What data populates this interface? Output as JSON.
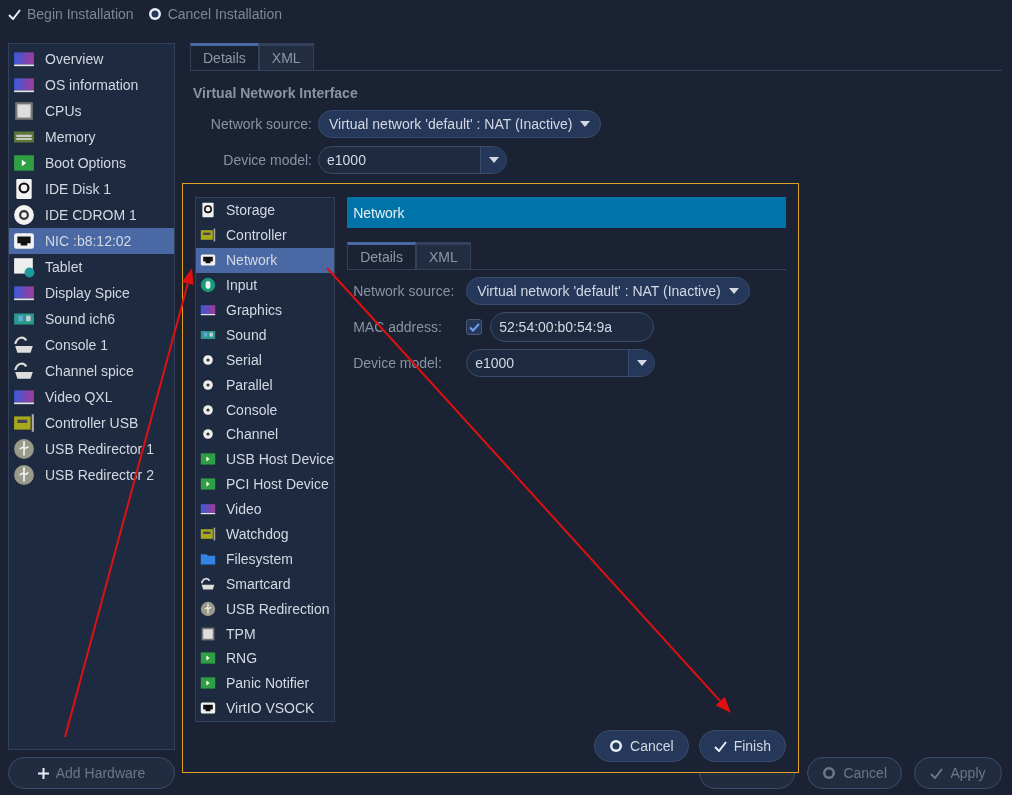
{
  "toolbar": [
    {
      "label": "Begin Installation",
      "kind": "check"
    },
    {
      "label": "Cancel Installation",
      "kind": "stop"
    }
  ],
  "hardware_list": [
    {
      "label": "Overview",
      "kind": "monitor",
      "selected": false
    },
    {
      "label": "OS information",
      "kind": "monitor",
      "selected": false
    },
    {
      "label": "CPUs",
      "kind": "chip",
      "selected": false
    },
    {
      "label": "Memory",
      "kind": "memory",
      "selected": false
    },
    {
      "label": "Boot Options",
      "kind": "play",
      "selected": false
    },
    {
      "label": "IDE Disk 1",
      "kind": "disk",
      "selected": false
    },
    {
      "label": "IDE CDROM 1",
      "kind": "disc",
      "selected": false
    },
    {
      "label": "NIC :b8:12:02",
      "kind": "port",
      "selected": true
    },
    {
      "label": "Tablet",
      "kind": "tablet",
      "selected": false
    },
    {
      "label": "Display Spice",
      "kind": "monitor",
      "selected": false
    },
    {
      "label": "Sound ich6",
      "kind": "sound",
      "selected": false
    },
    {
      "label": "Console 1",
      "kind": "cable",
      "selected": false
    },
    {
      "label": "Channel spice",
      "kind": "cable",
      "selected": false
    },
    {
      "label": "Video QXL",
      "kind": "monitor",
      "selected": false
    },
    {
      "label": "Controller USB",
      "kind": "card",
      "selected": false
    },
    {
      "label": "USB Redirector 1",
      "kind": "usb",
      "selected": false
    },
    {
      "label": "USB Redirector 2",
      "kind": "usb",
      "selected": false
    }
  ],
  "add_button": {
    "label": "Add Hardware"
  },
  "details": {
    "tabs": [
      {
        "label": "Details",
        "selected": true
      },
      {
        "label": "XML",
        "selected": false
      }
    ],
    "title": "Virtual Network Interface",
    "fields": [
      {
        "label": "Network source:",
        "kind": "dropdown",
        "value": "Virtual network 'default' : NAT (Inactive)"
      },
      {
        "label": "Device model:",
        "kind": "combo",
        "value": "e1000"
      }
    ]
  },
  "footer_buttons": [
    {
      "label": "Cancel",
      "kind": "stop",
      "disabled": true
    },
    {
      "label": "Apply",
      "kind": "check",
      "disabled": true
    }
  ],
  "dialog": {
    "categories": [
      {
        "label": "Storage",
        "kind": "disk",
        "selected": false
      },
      {
        "label": "Controller",
        "kind": "card",
        "selected": false
      },
      {
        "label": "Network",
        "kind": "port",
        "selected": true
      },
      {
        "label": "Input",
        "kind": "mouse",
        "selected": false
      },
      {
        "label": "Graphics",
        "kind": "monitor",
        "selected": false
      },
      {
        "label": "Sound",
        "kind": "sound",
        "selected": false
      },
      {
        "label": "Serial",
        "kind": "plug",
        "selected": false
      },
      {
        "label": "Parallel",
        "kind": "plug",
        "selected": false
      },
      {
        "label": "Console",
        "kind": "plug",
        "selected": false
      },
      {
        "label": "Channel",
        "kind": "plug",
        "selected": false
      },
      {
        "label": "USB Host Device",
        "kind": "play",
        "selected": false
      },
      {
        "label": "PCI Host Device",
        "kind": "play",
        "selected": false
      },
      {
        "label": "Video",
        "kind": "monitor",
        "selected": false
      },
      {
        "label": "Watchdog",
        "kind": "card",
        "selected": false
      },
      {
        "label": "Filesystem",
        "kind": "folder",
        "selected": false
      },
      {
        "label": "Smartcard",
        "kind": "cable",
        "selected": false
      },
      {
        "label": "USB Redirection",
        "kind": "usb",
        "selected": false
      },
      {
        "label": "TPM",
        "kind": "chip",
        "selected": false
      },
      {
        "label": "RNG",
        "kind": "play",
        "selected": false
      },
      {
        "label": "Panic Notifier",
        "kind": "play",
        "selected": false
      },
      {
        "label": "VirtIO VSOCK",
        "kind": "port",
        "selected": false
      }
    ],
    "header": "Network",
    "tabs": [
      {
        "label": "Details",
        "selected": true
      },
      {
        "label": "XML",
        "selected": false
      }
    ],
    "fields": [
      {
        "label": "Network source:",
        "kind": "dropdown",
        "value": "Virtual network 'default' : NAT (Inactive)"
      },
      {
        "label": "MAC address:",
        "kind": "checked-entry",
        "checked": true,
        "value": "52:54:00:b0:54:9a"
      },
      {
        "label": "Device model:",
        "kind": "combo",
        "value": "e1000"
      }
    ],
    "buttons": [
      {
        "label": "Cancel",
        "kind": "stop",
        "disabled": false
      },
      {
        "label": "Finish",
        "kind": "check",
        "disabled": false
      }
    ]
  }
}
